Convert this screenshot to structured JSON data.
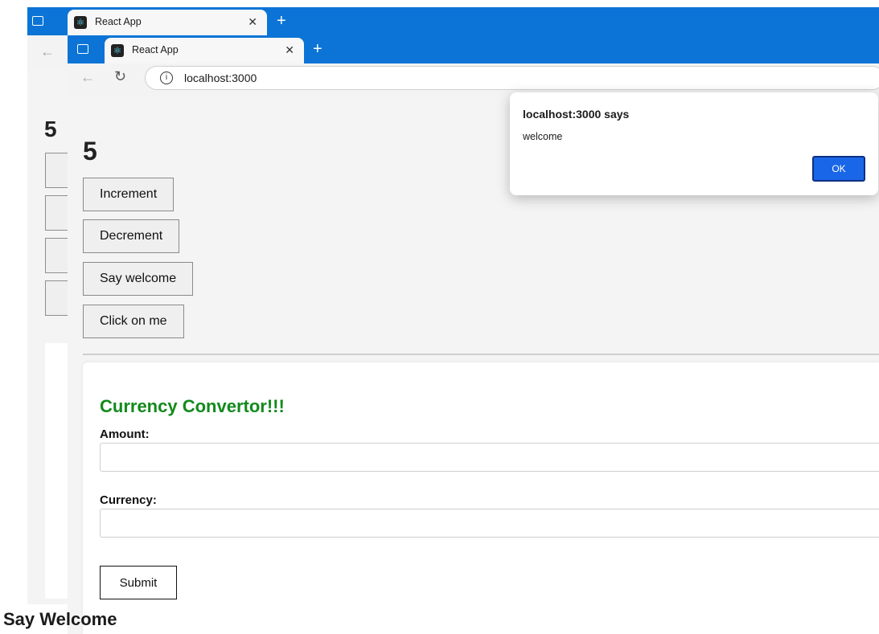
{
  "back_window": {
    "tab_title": "React App",
    "count": "5"
  },
  "front_window": {
    "tab_title": "React App",
    "url": "localhost:3000",
    "page": {
      "count": "5",
      "buttons": {
        "increment": "Increment",
        "decrement": "Decrement",
        "say_welcome": "Say welcome",
        "click_on_me": "Click on me"
      },
      "form": {
        "title": "Currency Convertor!!!",
        "amount_label": "Amount:",
        "amount_value": "",
        "currency_label": "Currency:",
        "currency_value": "",
        "submit_label": "Submit"
      }
    }
  },
  "alert": {
    "title": "localhost:3000 says",
    "message": "welcome",
    "ok_label": "OK"
  },
  "caption": "Say Welcome",
  "colors": {
    "tabbar": "#0b74d6",
    "form_title": "#138a1c",
    "alert_ok": "#1a66e8"
  }
}
